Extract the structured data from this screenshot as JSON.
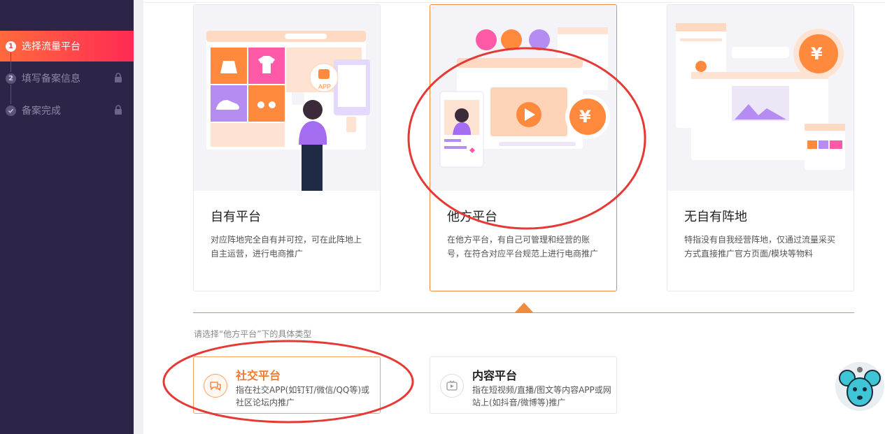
{
  "sidebar": {
    "steps": [
      {
        "number": "1",
        "label": "选择流量平台",
        "active": true,
        "locked": false
      },
      {
        "number": "2",
        "label": "填写备案信息",
        "active": false,
        "locked": true
      },
      {
        "number": "",
        "label": "备案完成",
        "active": false,
        "locked": true
      }
    ]
  },
  "cards": [
    {
      "title": "自有平台",
      "desc": "对应阵地完全自有并可控，可在此阵地上自主运营，进行电商推广",
      "app_label": "APP"
    },
    {
      "title": "他方平台",
      "desc": "在他方平台，有自己可管理和经营的账号，在符合对应平台规范上进行电商推广",
      "currency": "¥"
    },
    {
      "title": "无自有阵地",
      "desc": "特指没有自我经营阵地，仅通过流量采买方式直接推广官方页面/模块等物料",
      "currency": "¥"
    }
  ],
  "subprompt": "请选择“他方平台”下的具体类型",
  "options": [
    {
      "title": "社交平台",
      "desc": "指在社交APP(如钉钉/微信/QQ等)或社区论坛内推广",
      "icon": "chat-icon"
    },
    {
      "title": "内容平台",
      "desc": "指在短视频/直播/图文等内容APP或网站上(如抖音/微博等)推广",
      "icon": "video-icon"
    }
  ],
  "colors": {
    "accent": "#f08a3e",
    "sidebar_bg": "#2c2548",
    "active_step": "#ff3b4f",
    "annotation": "#e53935"
  }
}
